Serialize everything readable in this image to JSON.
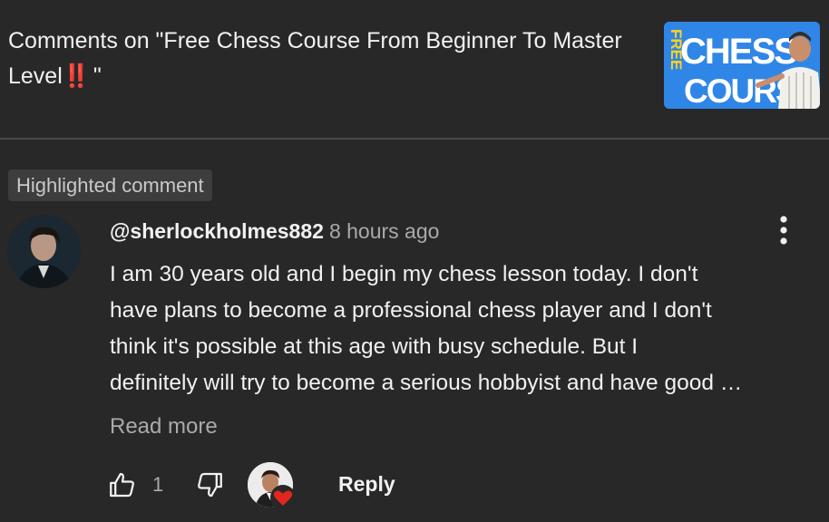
{
  "panel": {
    "title_prefix": "Comments on \"Free Chess Course From Beginner To Master Level",
    "title_emoji": "‼️",
    "title_suffix": "\"",
    "thumbnail": {
      "text_main": "CHESS",
      "text_second": "COURS",
      "text_vertical": "FREE",
      "bg_color": "#2f86e6"
    }
  },
  "chip": {
    "label": "Highlighted comment"
  },
  "comment": {
    "handle": "@sherlockholmes882",
    "time": "8 hours ago",
    "text_lines": [
      "I am 30 years old and I begin my chess lesson today. I don't",
      "have plans to become a professional chess player and I don't",
      "think it's possible at this age with busy schedule. But I",
      "definitely will try to become a serious hobbyist and have good …"
    ],
    "read_more": "Read more",
    "like_count": "1",
    "reply_label": "Reply"
  },
  "colors": {
    "background": "#282828",
    "secondary_text": "#aaaaaa",
    "heart": "#e0261d"
  }
}
